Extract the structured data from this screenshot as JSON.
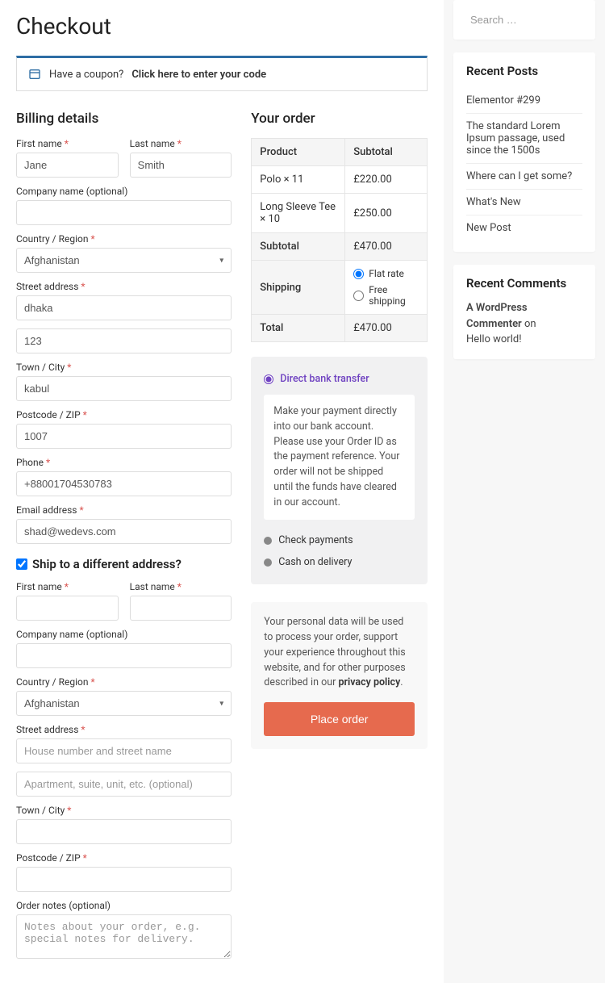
{
  "page_title": "Checkout",
  "coupon": {
    "prompt": "Have a coupon?",
    "link": "Click here to enter your code"
  },
  "billing": {
    "heading": "Billing details",
    "first_name_label": "First name",
    "last_name_label": "Last name",
    "company_label": "Company name (optional)",
    "country_label": "Country / Region",
    "street_label": "Street address",
    "town_label": "Town / City",
    "postcode_label": "Postcode / ZIP",
    "phone_label": "Phone",
    "email_label": "Email address",
    "first_name": "Jane",
    "last_name": "Smith",
    "company": "",
    "country": "Afghanistan",
    "street1": "dhaka",
    "street2": "123",
    "town": "kabul",
    "postcode": "1007",
    "phone": "+88001704530783",
    "email": "shad@wedevs.com"
  },
  "ship_toggle_label": "Ship to a different address?",
  "shipping": {
    "first_name_label": "First name",
    "last_name_label": "Last name",
    "company_label": "Company name (optional)",
    "country_label": "Country / Region",
    "street_label": "Street address",
    "town_label": "Town / City",
    "postcode_label": "Postcode / ZIP",
    "notes_label": "Order notes (optional)",
    "country": "Afghanistan",
    "street1_placeholder": "House number and street name",
    "street2_placeholder": "Apartment, suite, unit, etc. (optional)",
    "notes_placeholder": "Notes about your order, e.g. special notes for delivery."
  },
  "order": {
    "heading": "Your order",
    "col_product": "Product",
    "col_subtotal": "Subtotal",
    "rows": [
      {
        "product": "Polo  × 11",
        "subtotal": "£220.00"
      },
      {
        "product": "Long Sleeve Tee  × 10",
        "subtotal": "£250.00"
      }
    ],
    "subtotal_label": "Subtotal",
    "subtotal_value": "£470.00",
    "shipping_label": "Shipping",
    "shipping_options": {
      "flat": "Flat rate",
      "free": "Free shipping"
    },
    "total_label": "Total",
    "total_value": "£470.00"
  },
  "payment": {
    "methods": {
      "bank": "Direct bank transfer",
      "check": "Check payments",
      "cod": "Cash on delivery"
    },
    "bank_desc": "Make your payment directly into our bank account. Please use your Order ID as the payment reference. Your order will not be shipped until the funds have cleared in our account."
  },
  "privacy": {
    "text": "Your personal data will be used to process your order, support your experience throughout this website, and for other purposes described in our ",
    "link": "privacy policy"
  },
  "place_order_label": "Place order",
  "sidebar": {
    "search_placeholder": "Search …",
    "recent_posts_heading": "Recent Posts",
    "recent_posts": [
      "Elementor #299",
      "The standard Lorem Ipsum passage, used since the 1500s",
      "Where can I get some?",
      "What's New",
      "New Post"
    ],
    "recent_comments_heading": "Recent Comments",
    "comment_author": "A WordPress Commenter",
    "comment_on": " on ",
    "comment_post": "Hello world!"
  }
}
